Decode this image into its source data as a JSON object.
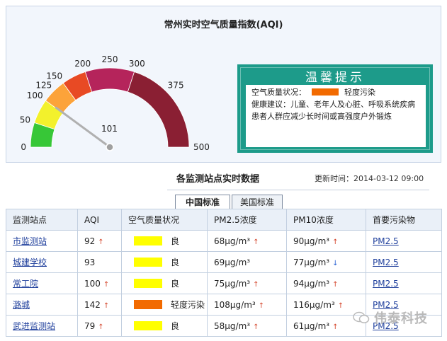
{
  "aqi": {
    "title": "常州实时空气质量指数(AQI)",
    "value": 101,
    "value_label": "101",
    "scale_labels": [
      "0",
      "50",
      "100",
      "125",
      "150",
      "200",
      "250",
      "300",
      "375",
      "500"
    ],
    "segment_colors": [
      "#37c737",
      "#f3f12c",
      "#fca33a",
      "#e84a24",
      "#b5245b",
      "#8a1f33"
    ]
  },
  "tip": {
    "title": "温馨提示",
    "quality_label": "空气质量状况：",
    "quality_color": "#f26a00",
    "quality_text": "轻度污染",
    "advice_label": "健康建议：",
    "advice_text": "儿童、老年人及心脏、呼吸系统疾病患者人群应减少长时间或高强度户外锻炼"
  },
  "section": {
    "title": "各监测站点实时数据",
    "update_time": "更新时间：2014-03-12 09:00"
  },
  "tabs": [
    {
      "label": "中国标准",
      "active": true
    },
    {
      "label": "美国标准",
      "active": false
    }
  ],
  "table": {
    "headers": [
      "监测站点",
      "AQI",
      "空气质量状况",
      "PM2.5浓度",
      "PM10浓度",
      "首要污染物"
    ],
    "rows": [
      {
        "station": "市监测站",
        "aqi": "92",
        "aqi_trend": "up",
        "level_color": "#ffff00",
        "level": "良",
        "pm25": "68μg/m³",
        "pm25_trend": "up",
        "pm10": "90μg/m³",
        "pm10_trend": "up",
        "pollutant": "PM2.5"
      },
      {
        "station": "城建学校",
        "aqi": "93",
        "aqi_trend": "",
        "level_color": "#ffff00",
        "level": "良",
        "pm25": "69μg/m³",
        "pm25_trend": "",
        "pm10": "77μg/m³",
        "pm10_trend": "down",
        "pollutant": "PM2.5"
      },
      {
        "station": "常工院",
        "aqi": "100",
        "aqi_trend": "up",
        "level_color": "#ffff00",
        "level": "良",
        "pm25": "75μg/m³",
        "pm25_trend": "up",
        "pm10": "94μg/m³",
        "pm10_trend": "up",
        "pollutant": "PM2.5"
      },
      {
        "station": "潞城",
        "aqi": "142",
        "aqi_trend": "up",
        "level_color": "#f26a00",
        "level": "轻度污染",
        "pm25": "108μg/m³",
        "pm25_trend": "up",
        "pm10": "116μg/m³",
        "pm10_trend": "up",
        "pollutant": "PM2.5"
      },
      {
        "station": "武进监测站",
        "aqi": "79",
        "aqi_trend": "up",
        "level_color": "#ffff00",
        "level": "良",
        "pm25": "58μg/m³",
        "pm25_trend": "up",
        "pm10": "61μg/m³",
        "pm10_trend": "up",
        "pollutant": "PM2.5"
      }
    ]
  },
  "watermark": "伟泰科技"
}
